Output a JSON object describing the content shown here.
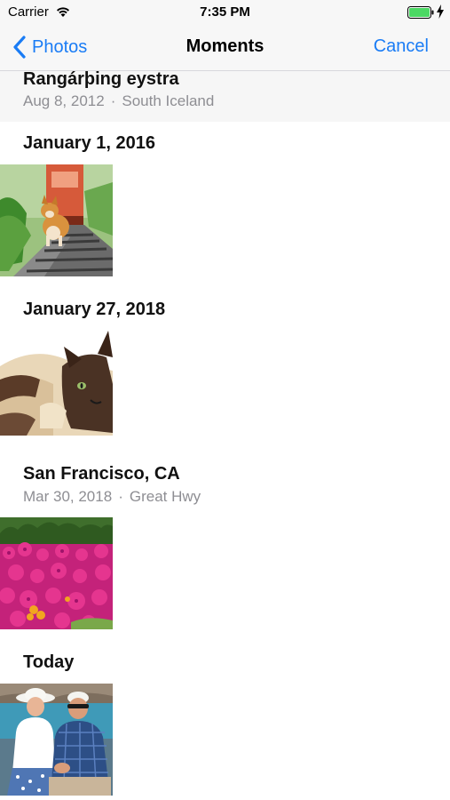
{
  "status_bar": {
    "carrier": "Carrier",
    "time": "7:35 PM",
    "icons": [
      "wifi-icon",
      "battery-icon",
      "charging-bolt-icon"
    ],
    "battery_color": "#4cd964"
  },
  "nav": {
    "back_label": "Photos",
    "title": "Moments",
    "cancel_label": "Cancel",
    "accent_color": "#1a7cf5"
  },
  "moments": [
    {
      "title": "Rangárþing eystra",
      "date": "Aug 8, 2012",
      "location": "South Iceland",
      "photos": []
    },
    {
      "title": "January 1, 2016",
      "photos": [
        "corgi-on-railway-tracks"
      ]
    },
    {
      "title": "January 27, 2018",
      "photos": [
        "siamese-cat-lying-down"
      ]
    },
    {
      "title": "San Francisco, CA",
      "date": "Mar 30, 2018",
      "location": "Great Hwy",
      "photos": [
        "pink-flower-bed"
      ]
    },
    {
      "title": "Today",
      "photos": [
        "couple-at-seaside"
      ]
    }
  ],
  "separator": "·"
}
